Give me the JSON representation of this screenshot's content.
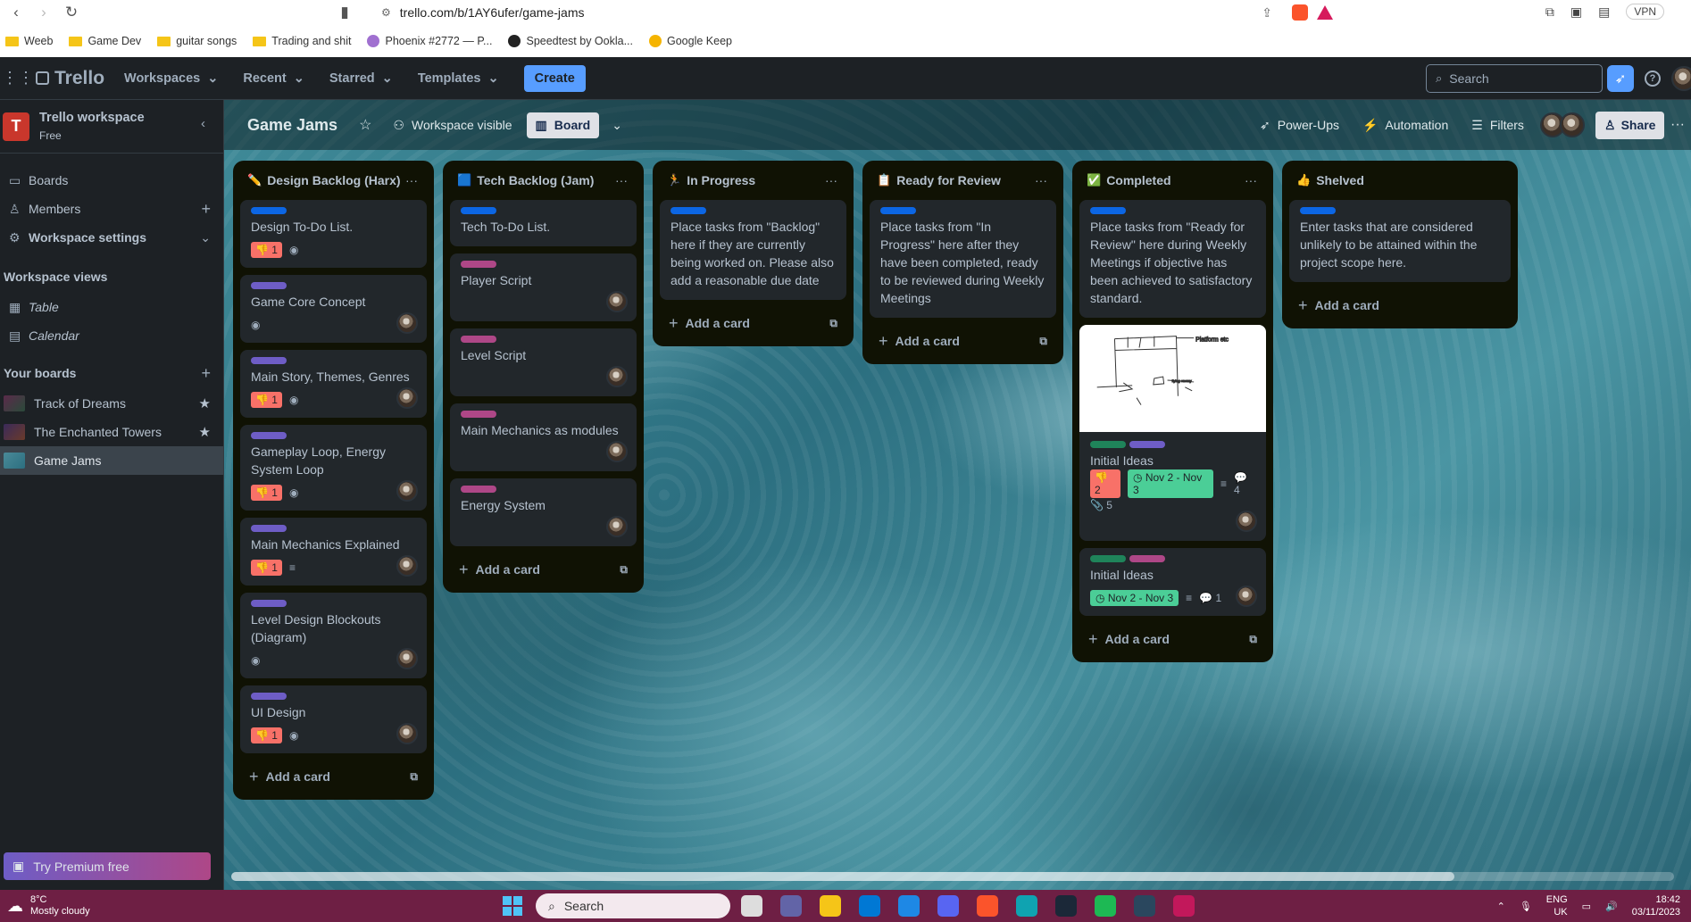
{
  "browser": {
    "url": "trello.com/b/1AY6ufer/game-jams",
    "vpn": "VPN",
    "bookmarks": [
      {
        "label": "Weeb",
        "type": "folder"
      },
      {
        "label": "Game Dev",
        "type": "folder"
      },
      {
        "label": "guitar songs",
        "type": "folder"
      },
      {
        "label": "Trading and shit",
        "type": "folder"
      },
      {
        "label": "Phoenix #2772 — P...",
        "type": "site",
        "color": "#a070d0"
      },
      {
        "label": "Speedtest by Ookla...",
        "type": "site",
        "color": "#222222"
      },
      {
        "label": "Google Keep",
        "type": "site",
        "color": "#f5b400"
      }
    ]
  },
  "topbar": {
    "brand": "Trello",
    "menus": [
      "Workspaces",
      "Recent",
      "Starred",
      "Templates"
    ],
    "create": "Create",
    "search_placeholder": "Search"
  },
  "sidebar": {
    "workspace_initial": "T",
    "workspace_name": "Trello workspace",
    "workspace_plan": "Free",
    "nav": [
      "Boards",
      "Members",
      "Workspace settings"
    ],
    "views_heading": "Workspace views",
    "views": [
      "Table",
      "Calendar"
    ],
    "boards_heading": "Your boards",
    "boards": [
      {
        "name": "Track of Dreams",
        "starred": true
      },
      {
        "name": "The Enchanted Towers",
        "starred": true
      },
      {
        "name": "Game Jams",
        "starred": false,
        "active": true
      }
    ],
    "premium": "Try Premium free"
  },
  "board": {
    "title": "Game Jams",
    "visibility": "Workspace visible",
    "view": "Board",
    "powerups": "Power-Ups",
    "automation": "Automation",
    "filters": "Filters",
    "share": "Share"
  },
  "lists": [
    {
      "title": "Design Backlog (Harx)",
      "emoji": "✏️",
      "cards": [
        {
          "title": "Design To-Do List.",
          "labels": [
            "#0c66e4"
          ],
          "votes": "1",
          "watch": true
        },
        {
          "title": "Game Core Concept",
          "labels": [
            "#6e5dc6"
          ],
          "watch": true,
          "avatar": true
        },
        {
          "title": "Main Story, Themes, Genres",
          "labels": [
            "#6e5dc6"
          ],
          "votes": "1",
          "watch": true,
          "avatar": true
        },
        {
          "title": "Gameplay Loop, Energy System Loop",
          "labels": [
            "#6e5dc6"
          ],
          "votes": "1",
          "watch": true,
          "avatar": true
        },
        {
          "title": "Main Mechanics Explained",
          "labels": [
            "#6e5dc6"
          ],
          "votes": "1",
          "desc": true,
          "avatar": true
        },
        {
          "title": "Level Design Blockouts (Diagram)",
          "labels": [
            "#6e5dc6"
          ],
          "watch": true,
          "avatar": true
        },
        {
          "title": "UI Design",
          "labels": [
            "#6e5dc6"
          ],
          "votes": "1",
          "watch": true,
          "avatar": true
        }
      ],
      "add": "Add a card"
    },
    {
      "title": "Tech Backlog (Jam)",
      "emoji": "🟦",
      "cards": [
        {
          "title": "Tech To-Do List.",
          "labels": [
            "#0c66e4"
          ]
        },
        {
          "title": "Player Script",
          "labels": [
            "#ae4787"
          ],
          "avatar": true
        },
        {
          "title": "Level Script",
          "labels": [
            "#ae4787"
          ],
          "avatar": true
        },
        {
          "title": "Main Mechanics as modules",
          "labels": [
            "#ae4787"
          ],
          "avatar": true
        },
        {
          "title": "Energy System",
          "labels": [
            "#ae4787"
          ],
          "avatar": true
        }
      ],
      "add": "Add a card"
    },
    {
      "title": "In Progress",
      "emoji": "🏃",
      "cards": [
        {
          "title": "Place tasks from \"Backlog\" here if they are currently being worked on. Please also add a reasonable due date",
          "labels": [
            "#0c66e4"
          ]
        }
      ],
      "add": "Add a card"
    },
    {
      "title": "Ready for Review",
      "emoji": "📋",
      "cards": [
        {
          "title": "Place tasks from \"In Progress\" here after they have been completed, ready to be reviewed during Weekly Meetings",
          "labels": [
            "#0c66e4"
          ]
        }
      ],
      "add": "Add a card"
    },
    {
      "title": "Completed",
      "emoji": "✅",
      "cards": [
        {
          "title": "Place tasks from \"Ready for Review\" here during Weekly Meetings if objective has been achieved to satisfactory standard.",
          "labels": [
            "#0c66e4"
          ]
        },
        {
          "title": "Initial Ideas",
          "cover": true,
          "labels": [
            "#1f845a",
            "#6e5dc6"
          ],
          "votes": "2",
          "dates": "Nov 2 - Nov 3",
          "desc": true,
          "comments": "4",
          "attachments": "5",
          "avatar": true
        },
        {
          "title": "Initial Ideas",
          "labels": [
            "#1f845a",
            "#ae4787"
          ],
          "dates": "Nov 2 - Nov 3",
          "desc": true,
          "comments": "1",
          "avatar": true
        }
      ],
      "add": "Add a card"
    },
    {
      "title": "Shelved",
      "emoji": "👍",
      "cards": [
        {
          "title": "Enter tasks that are considered unlikely to be attained within the project scope here.",
          "labels": [
            "#0c66e4"
          ]
        }
      ],
      "add": "Add a card"
    }
  ],
  "taskbar": {
    "temp": "8°C",
    "weather": "Mostly cloudy",
    "search": "Search",
    "lang": "ENG",
    "region": "UK",
    "time": "18:42",
    "date": "03/11/2023"
  }
}
